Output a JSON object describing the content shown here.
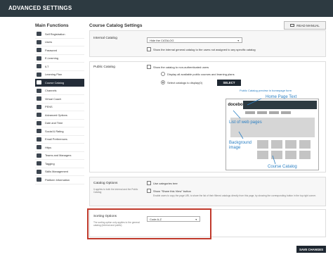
{
  "header": {
    "title": "ADVANCED SETTINGS"
  },
  "sidebar": {
    "title": "Main Functions",
    "items": [
      {
        "label": "Self Registration",
        "icon": "user-plus-icon"
      },
      {
        "label": "Users",
        "icon": "users-icon"
      },
      {
        "label": "Password",
        "icon": "key-icon"
      },
      {
        "label": "E-Learning",
        "icon": "monitor-icon"
      },
      {
        "label": "ILT",
        "icon": "presentation-icon"
      },
      {
        "label": "Learning Plan",
        "icon": "learning-plan-icon"
      },
      {
        "label": "Course Catalog",
        "icon": "catalog-icon",
        "active": true
      },
      {
        "label": "Channels",
        "icon": "channels-icon"
      },
      {
        "label": "Virtual Coach",
        "icon": "chat-icon"
      },
      {
        "label": "PENS",
        "icon": "pens-icon"
      },
      {
        "label": "Advanced Options",
        "icon": "gear-icon"
      },
      {
        "label": "Date and Time",
        "icon": "clock-icon"
      },
      {
        "label": "Social & Rating",
        "icon": "star-icon"
      },
      {
        "label": "Email Preferences",
        "icon": "mail-icon"
      },
      {
        "label": "Https",
        "icon": "lock-icon"
      },
      {
        "label": "Teams and Managers",
        "icon": "team-icon"
      },
      {
        "label": "Tagging",
        "icon": "tag-icon"
      },
      {
        "label": "Skills Management",
        "icon": "skills-icon"
      },
      {
        "label": "Platform Information",
        "icon": "info-icon"
      }
    ]
  },
  "content": {
    "title": "Course Catalog Settings",
    "read_manual": "READ MANUAL",
    "internal_catalog": {
      "label": "Internal Catalog",
      "select_value": "Hide the CATALOG",
      "checkbox_label": "Show the internal general catalog to the users not assigned to any specific catalog"
    },
    "public_catalog": {
      "label": "Public Catalog",
      "checkbox_label": "Show the catalog to non-authenticated users",
      "radio1": "Display all available public courses and learning plans",
      "radio2": "Select catalogs to display(0)",
      "select_button": "SELECT",
      "preview_caption": "Public Catalog preview in homepage form",
      "preview_logo": "docebo",
      "annotations": {
        "home_page_text": "Home Page Text",
        "list_of_web_pages": "List of web pages",
        "background_image": "Background image",
        "course_catalog": "Course Catalog"
      }
    },
    "catalog_options": {
      "label": "Catalog Options",
      "desc": "It applies to both the internal and the Public Catalog",
      "opt1": "Use categories tree",
      "opt2": "Show \"Share this View\" button",
      "opt2_desc": "Enable users to copy the page URL to share the list of their filtered catalogs directly from this page, by showing the corresponding button in the top right corner."
    },
    "sorting_options": {
      "label": "Sorting Options",
      "desc": "The sorting option only applies to the general catalog (internal and public)",
      "select_value": "Code A-Z"
    },
    "save_button": "SAVE CHANGES"
  },
  "colors": {
    "topbar": "#2d3a41",
    "active_item": "#232c38",
    "annotation_blue": "#2a7fc3",
    "highlight_red": "#c0392b"
  }
}
